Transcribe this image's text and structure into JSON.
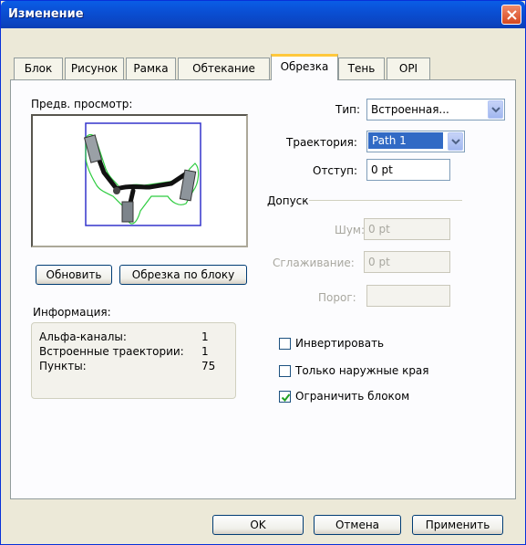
{
  "window": {
    "title": "Изменение"
  },
  "tabs": [
    {
      "label": "Блок"
    },
    {
      "label": "Рисунок"
    },
    {
      "label": "Рамка"
    },
    {
      "label": "Обтекание"
    },
    {
      "label": "Обрезка"
    },
    {
      "label": "Тень"
    },
    {
      "label": "OPI"
    }
  ],
  "active_tab": "Обрезка",
  "preview": {
    "label": "Предв. просмотр:"
  },
  "buttons": {
    "update": "Обновить",
    "crop_to_box": "Обрезка по блоку",
    "ok": "OK",
    "cancel": "Отмена",
    "apply": "Применить"
  },
  "info": {
    "label": "Информация:",
    "rows": [
      {
        "key": "Альфа-каналы:",
        "value": "1"
      },
      {
        "key": "Встроенные траектории:",
        "value": "1"
      },
      {
        "key": "Пункты:",
        "value": "75"
      }
    ]
  },
  "fields": {
    "type": {
      "label": "Тип:",
      "value": "Встроенная..."
    },
    "path": {
      "label": "Траектория:",
      "value": "Path 1"
    },
    "offset": {
      "label": "Отступ:",
      "value": "0 pt"
    }
  },
  "tolerance": {
    "label": "Допуск",
    "noise": {
      "label": "Шум:",
      "value": "0 pt"
    },
    "smoothing": {
      "label": "Сглаживание:",
      "value": "0 pt"
    },
    "threshold": {
      "label": "Порог:",
      "value": ""
    }
  },
  "checkboxes": [
    {
      "label": "Инвертировать",
      "checked": false
    },
    {
      "label": "Только наружные края",
      "checked": false
    },
    {
      "label": "Ограничить блоком",
      "checked": true
    }
  ],
  "colors": {
    "titlebar": "#0a4fd4",
    "tab_active_accent": "#ffc83c",
    "path_outline": "#2ecc40",
    "box_outline": "#3333cc"
  }
}
